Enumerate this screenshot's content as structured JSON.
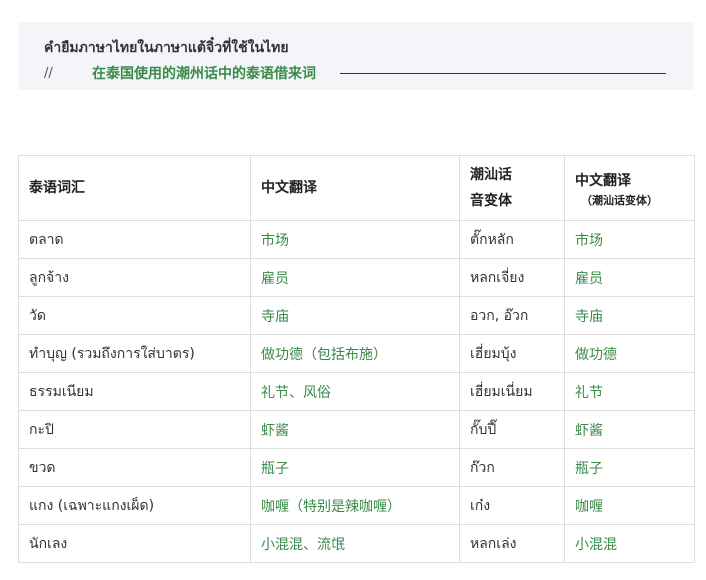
{
  "header": {
    "thai_title": "คำยืมภาษาไทยในภาษาแต้จิ๋วที่ใช้ในไทย",
    "prefix": "//",
    "subtitle": "在泰国使用的潮州话中的泰语借来词"
  },
  "table": {
    "headers": {
      "thai": "泰语词汇",
      "cn": "中文翻译",
      "tc_line1": "潮汕话",
      "tc_line2": "音变体",
      "tcv_line1": "中文翻译",
      "tcv_line2": "（潮汕话变体）"
    },
    "rows": [
      {
        "thai": "ตลาด",
        "cn": "市场",
        "tc": "ตั๊กหลัก",
        "tcv": "市场"
      },
      {
        "thai": "ลูกจ้าง",
        "cn": "雇员",
        "tc": "หลกเจี่ยง",
        "tcv": "雇员"
      },
      {
        "thai": "วัด",
        "cn": "寺庙",
        "tc": "อวก, อ๊วก",
        "tcv": "寺庙"
      },
      {
        "thai": "ทำบุญ (รวมถึงการใส่บาตร)",
        "cn": "做功德（包括布施）",
        "tc": "เฮี่ยมบุ้ง",
        "tcv": "做功德"
      },
      {
        "thai": "ธรรมเนียม",
        "cn": "礼节、风俗",
        "tc": "เฮี่ยมเนี่ยม",
        "tcv": "礼节"
      },
      {
        "thai": "กะปิ",
        "cn": "虾酱",
        "tc": "กั๊บปี๊",
        "tcv": "虾酱"
      },
      {
        "thai": "ขวด",
        "cn": "瓶子",
        "tc": "ก๊วก",
        "tcv": "瓶子"
      },
      {
        "thai": "แกง (เฉพาะแกงเผ็ด)",
        "cn": "咖喱（特别是辣咖喱）",
        "tc": "เก๋ง",
        "tcv": "咖喱"
      },
      {
        "thai": "นักเลง",
        "cn": "小混混、流氓",
        "tc": "หลกเล่ง",
        "tcv": "小混混"
      }
    ]
  }
}
